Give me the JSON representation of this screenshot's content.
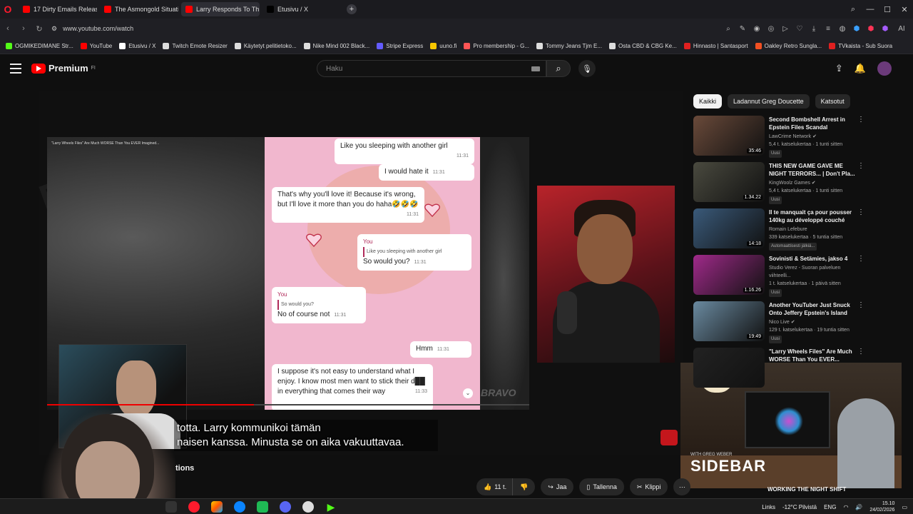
{
  "browser": {
    "tabs": [
      {
        "label": "17 Dirty Emails Released in",
        "color": "#ff0000",
        "active": false
      },
      {
        "label": "The Asmongold Situation",
        "color": "#ff0000",
        "active": false
      },
      {
        "label": "Larry Responds To Th",
        "color": "#ff0000",
        "active": true
      },
      {
        "label": "Etusivu / X",
        "color": "#000000",
        "active": false
      }
    ],
    "new_tab_icon": "plus-icon",
    "url": "www.youtube.com/watch",
    "ai_label": "AI",
    "bookmarks": [
      {
        "label": "OGMIKEDIMANE Str...",
        "color": "#53fc18"
      },
      {
        "label": "YouTube",
        "color": "#ff0000"
      },
      {
        "label": "Etusivu / X",
        "color": "#ffffff"
      },
      {
        "label": "Twitch Emote Resizer",
        "color": "#dddddd"
      },
      {
        "label": "Käytetyt pelitietoko...",
        "color": "#dddddd"
      },
      {
        "label": "Nike Mind 002 Black...",
        "color": "#dddddd"
      },
      {
        "label": "Stripe Express",
        "color": "#635bff"
      },
      {
        "label": "uuno.fi",
        "color": "#f7c600"
      },
      {
        "label": "Pro membership - G...",
        "color": "#ff5555"
      },
      {
        "label": "Tommy Jeans Tjm E...",
        "color": "#dddddd"
      },
      {
        "label": "Osta CBD & CBG Ke...",
        "color": "#dddddd"
      },
      {
        "label": "Hinnasto | Santasport",
        "color": "#e02020"
      },
      {
        "label": "Oakley Retro Sungla...",
        "color": "#f25022"
      },
      {
        "label": "TVkaista - Sub Suora",
        "color": "#e02020"
      }
    ]
  },
  "youtube": {
    "logo_text": "Premium",
    "logo_region": "FI",
    "search_placeholder": "Haku",
    "player": {
      "inner_title": "\"Larry Wheels Files\" Are Much WORSE Than You EVER Imagined...",
      "watermark": "YDR",
      "brand": "BRAVO",
      "chat": [
        {
          "text": "Like you sleeping with another girl",
          "time": "11:31"
        },
        {
          "text": "I would hate it",
          "time": "11:31"
        },
        {
          "text": "That's why you'll love it! Because it's wrong, but I'll love it more than you do haha🤣🤣🤣",
          "time": "11:31"
        },
        {
          "reply_name": "You",
          "reply_text": "Like you sleeping with another girl",
          "text": "So would you?",
          "time": "11:31"
        },
        {
          "reply_name": "You",
          "reply_text": "So would you?",
          "text": "No of course not",
          "time": "11:31"
        },
        {
          "text": "Hmm",
          "time": "11:31"
        },
        {
          "text": "I suppose it's not easy to understand what I enjoy. I know most men want to stick their d██ in everything that comes their way",
          "time": "11:33"
        }
      ],
      "subtitle_line1": "totta.  Larry kommunikoi tämän",
      "subtitle_line2": "naisen kanssa. Minusta se on aika vakuuttavaa."
    },
    "description_label": "tions",
    "actions": {
      "like_count": "11 t.",
      "share": "Jaa",
      "save": "Tallenna",
      "clip": "Klippi"
    },
    "chips": [
      "Kaikki",
      "Ladannut Greg Doucette",
      "Katsotut"
    ],
    "recommendations": [
      {
        "title": "Second Bombshell Arrest in Epstein Files Scandal",
        "channel": "LawCrime Network ✔",
        "views": "5,4 t. katselukertaa · 1 tunti sitten",
        "badge": "Uusi",
        "duration": "35:46",
        "thumb": "#6a4a3a"
      },
      {
        "title": "THIS NEW GAME GAVE ME NIGHT TERRORS... | Don't Pla...",
        "channel": "KingWoolz Games ✔",
        "views": "5,4 t. katselukertaa · 1 tunti sitten",
        "badge": "Uusi",
        "duration": "1.34.22",
        "thumb": "#4a4a3f"
      },
      {
        "title": "Il te manquait ça pour pousser 140kg au développé couché",
        "channel": "Romain Lefebure",
        "views": "339 katselukertaa · 5 tuntia sitten",
        "badge": "Automaattisesti jälkiä...",
        "duration": "14:18",
        "thumb": "#3a5a7a"
      },
      {
        "title": "Sovinisti & Setämies, jakso 4",
        "channel": "Studio Verez - Suoran palveluen viihteelli...",
        "views": "1 t. katselukertaa · 1 päivä sitten",
        "badge": "Uusi",
        "duration": "1.16.26",
        "thumb": "#a02a8a"
      },
      {
        "title": "Another YouTuber Just Snuck Onto Jeffery Epstein's Island",
        "channel": "Nico Live ✔",
        "views": "129 t. katselukertaa · 19 tuntia sitten",
        "badge": "Uusi",
        "duration": "19:49",
        "thumb": "#6a8aa0"
      },
      {
        "title": "\"Larry Wheels Files\" Are Much WORSE Than You EVER...",
        "channel": "",
        "views": "",
        "badge": "",
        "duration": "",
        "thumb": "#222"
      }
    ],
    "partial_rec_title": "WORKING THE NIGHT SHIFT",
    "sidebar_cam_brand": "SIDEBAR",
    "sidebar_cam_sub": "WITH GREG WEBER"
  },
  "taskbar": {
    "links": "Links",
    "weather": "-12°C Pilvistä",
    "lang": "ENG",
    "time": "15.10",
    "date": "24/02/2026"
  }
}
